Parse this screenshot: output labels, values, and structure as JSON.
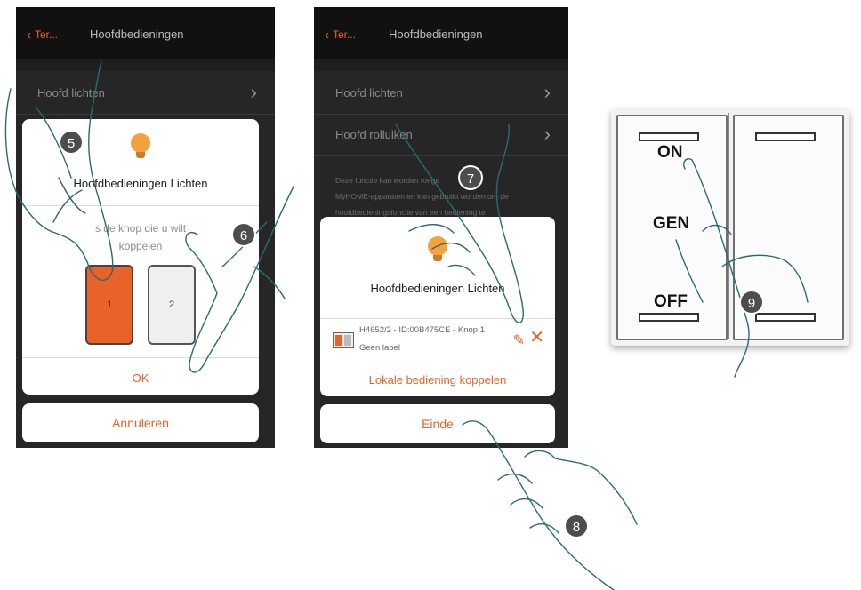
{
  "screens": [
    {
      "back_label": "Ter...",
      "title": "Hoofdbedieningen",
      "rows": [
        {
          "label": "Hoofd lichten"
        }
      ],
      "dialog": {
        "title": "Hoofdbedieningen Lichten",
        "instruction_line1": "s de knop die u wilt",
        "instruction_line2": "koppelen",
        "keys": [
          {
            "label": "1",
            "selected": true
          },
          {
            "label": "2",
            "selected": false
          }
        ],
        "ok_label": "OK"
      },
      "cancel_label": "Annuleren"
    },
    {
      "back_label": "Ter...",
      "title": "Hoofdbedieningen",
      "rows": [
        {
          "label": "Hoofd lichten"
        },
        {
          "label": "Hoofd rolluiken"
        }
      ],
      "description": [
        "Deze functie kan worden toege",
        "MyHOME-apparaten en kan gebruikt worden om de",
        "hoofdbedieningsfunctie van een bediening te"
      ],
      "dialog": {
        "title": "Hoofdbedieningen Lichten",
        "device_line1": "H4652/2 - ID:00B475CE - Knop 1",
        "device_line2": "Geen label",
        "link_label": "Lokale bediening koppelen"
      },
      "done_label": "Einde"
    }
  ],
  "device_switch": {
    "on_label": "ON",
    "gen_label": "GEN",
    "off_label": "OFF"
  },
  "steps": [
    "5",
    "6",
    "7",
    "8",
    "9"
  ],
  "icons": {
    "bulb": "light-bulb-icon",
    "pencil": "pencil-icon",
    "close": "close-icon",
    "chevron": "chevron-right-icon",
    "back": "chevron-left-icon"
  },
  "colors": {
    "accent": "#e8622a",
    "screen_bg": "#262626",
    "selected_key": "#e8622a",
    "badge": "#4d4d4d"
  }
}
